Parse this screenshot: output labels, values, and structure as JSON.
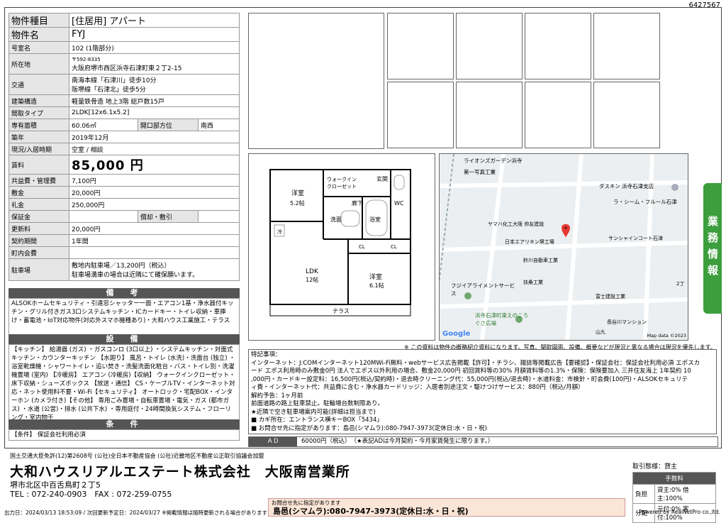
{
  "doc_id": "6427567",
  "spec": {
    "type_label": "物件種目",
    "type_value": "[住居用]  アパート",
    "name_label": "物件名",
    "name_value": "FYJ",
    "room_label": "号室名",
    "room_value": "102 (1階部分)",
    "addr_label": "所在地",
    "zip": "〒592-8335",
    "addr_value": "大阪府堺市西区浜寺石津町東２丁2-15",
    "traffic_label": "交通",
    "traffic_1": "南海本線「石津川」徒歩10分",
    "traffic_2": "阪堺線「石津北」徒歩5分",
    "structure_label": "建築構造",
    "structure_value": "軽量鉄骨造 地上3階 総戸数15戸",
    "layout_label": "間取タイプ",
    "layout_value": "2LDK[12x6.1x5.2]",
    "area_label": "専有面積",
    "area_value": "60.06㎡",
    "dir_label": "開口部方位",
    "dir_value": "南西",
    "built_label": "築年",
    "built_value": "2019年12月",
    "status_label": "現況/入居時期",
    "status_value": "空室 / 相談",
    "rent_label": "賃料",
    "rent_value": "85,000 円",
    "common_label": "共益費・管理費",
    "common_value": "7,100円",
    "deposit_label": "敷金",
    "deposit_value": "20,000円",
    "key_label": "礼金",
    "key_value": "250,000円",
    "guarantee_label": "保証金",
    "amort_label": "償却・敷引",
    "renew_label": "更新料",
    "renew_value": "20,000円",
    "term_label": "契約期間",
    "term_value": "1年間",
    "town_label": "町内会費",
    "parking_label": "駐車場",
    "parking_1": "敷地内駐車場／13,200円（税込）",
    "parking_2": "駐車場満車の場合は近隣にて確保願います。"
  },
  "remarks": {
    "title": "備　考",
    "text": "ALSOKホームセキュリティ・引違窓シャッター一面・エアコン1基・浄水器付キッチン・グリル付きガス3口システムキッチン・ICカードキー・トイレ収納・車挿け・蓄電池・IoT対応物件(対応外スマホ機種あり)・大和ハウス工業施工・テラス"
  },
  "facilities": {
    "title": "設　備",
    "text": "【キッチン】 給湯器 (ガス) ・ガスコンロ (3口以上) ・システムキッチン・対面式キッチン・カウンターキッチン 【水廻り】 風呂・トイレ (水洗)・洗面台 (独立) ・浴室乾燥機・シャワートイレ・追い焚き・洗髪洗面化粧台・バス・トイレ別・洗濯機置場 (室内) 【冷暖房】 エアコン (冷暖房)【収納】 ウォークインクローゼット・床下収納・シューズボックス 【放送・通信】 CS・ケーブルTV・インターネット対応・ネット使用料不要・Wi-Fi【セキュリティ】 オートロック・宅配BOX・インターホン (カメラ付き)【その他】 専用ごみ置場・自転車置場・電気・ガス (都市ガス) ・水道 (公営)・排水 (公共下水) ・専用庭付・24時間換気システム・フローリング・室内物干"
  },
  "conditions": {
    "title": "条　件",
    "text": "【条件】 保証会社利用必須"
  },
  "floorplan": {
    "walkin": "ウォークイン",
    "closet": "クローゼット",
    "yoshitsu1": "洋室",
    "yoshitsu1_size": "5.2帖",
    "genkan": "玄関",
    "wc": "WC",
    "rouka": "廊下",
    "senmen": "洗面",
    "yokushitsu": "浴室",
    "cl1": "CL",
    "cl2": "CL",
    "ldk": "LDK",
    "ldk_size": "12帖",
    "yoshitsu2": "洋室",
    "yoshitsu2_size": "6.1帖",
    "terrace": "テラス",
    "reizo": "冷"
  },
  "map": {
    "labels": [
      "ライオンズガーデン浜寺",
      "第一写真工業",
      "ダスキン 浜寺石津支店",
      "ラ・シーム・フルール石津",
      "ヤマハ化工大阪 帅友建設",
      "日本エアリキン堺工場",
      "サンシャインコート石津",
      "鈴川自動車工業",
      "扶桑工業",
      "富士建設工業",
      "フジイアライメントサービス",
      "浜寺石津町東えのころぐさ広場",
      "長谷川マンション",
      "山九",
      "2丁"
    ],
    "google": "Google",
    "attribution": "Map data ©2023"
  },
  "note": "※ この資料は物件の概略紹介資料になります。写真、間取図面、設備、概要などが現況と異なる場合は現況を優先します。",
  "special": {
    "title": "特記事項：",
    "lines": [
      "インターネット：J:COMインターネット120MWi-Fi無料・webサービス広告掲載【許可】・チラシ、雑誌等掲載広告【要確認】・保証会社：保証会社利用必須 エポスカ",
      "ード エポス利用時のみ敷金0円 法人でエポス以外利用の場合、敷金20,000円 初回賃料等の30% 月額賃料等の1.3%・保険：保険要加入 三井住友海上 1年契約 10",
      ",000円・カードキー設定料：16,500円(税込/契約時)・退去時クリーニング代：55,000円(税込/退去時)・水道料金：市検針・町会費(100円)・ALSOKセキュリテ",
      "ィ費・インターネット代：共益費に含む・浄水器カードリッジ：入居者別途注文・駆けつけサービス：880円（税込/月額）",
      "解約予告：1ヶ月前",
      "前面道路の路上駐車禁止。駐輪場台数制限あり。",
      "★近隣で空き駐車場案内可能(詳細は担当まで)",
      "■ カギ所在：エントランス横キーBOX「5434」",
      "■ お問合せ先に指定があります：島邑(シマムラ):080-7947-3973(定休日:水・日・祝)"
    ]
  },
  "ad": {
    "label": "ＡＤ",
    "value": "60000円（税込）　（★表記ADは今月契約・今月家賃発生に限ります。）"
  },
  "sidebar": {
    "label": "業務情報"
  },
  "footer": {
    "assoc": "国土交通大臣免許(12)第2608号 (公社)全日本不動産協会 (公社)近畿地区不動産公正取引協議会加盟",
    "company": "大和ハウスリアルエステート株式会社　大阪南営業所",
    "addr": "堺市北区中百舌鳥町２丁5",
    "tel": "TEL : 072-240-0903　FAX : 072-259-0755",
    "fee_title": "取引態様：貸主",
    "fee_head": "手数料",
    "fee_row1_l": "負担",
    "fee_row1_v": "貸主:0% 借主:100%",
    "fee_row2_l": "分配",
    "fee_row2_v": "元付:0% 客付:100%",
    "contact_small": "お問合せ先に指定があります",
    "contact_main": "島邑(シマムラ):080-7947-3973(定休日:水・日・祝)",
    "print": "出力日：2024/03/13 18:53:09 / 次回更新予定日：2024/03/27 ※掲載情報は随時更新される場合があります",
    "powered": "Powered by RealNetPro co.,ltd."
  }
}
